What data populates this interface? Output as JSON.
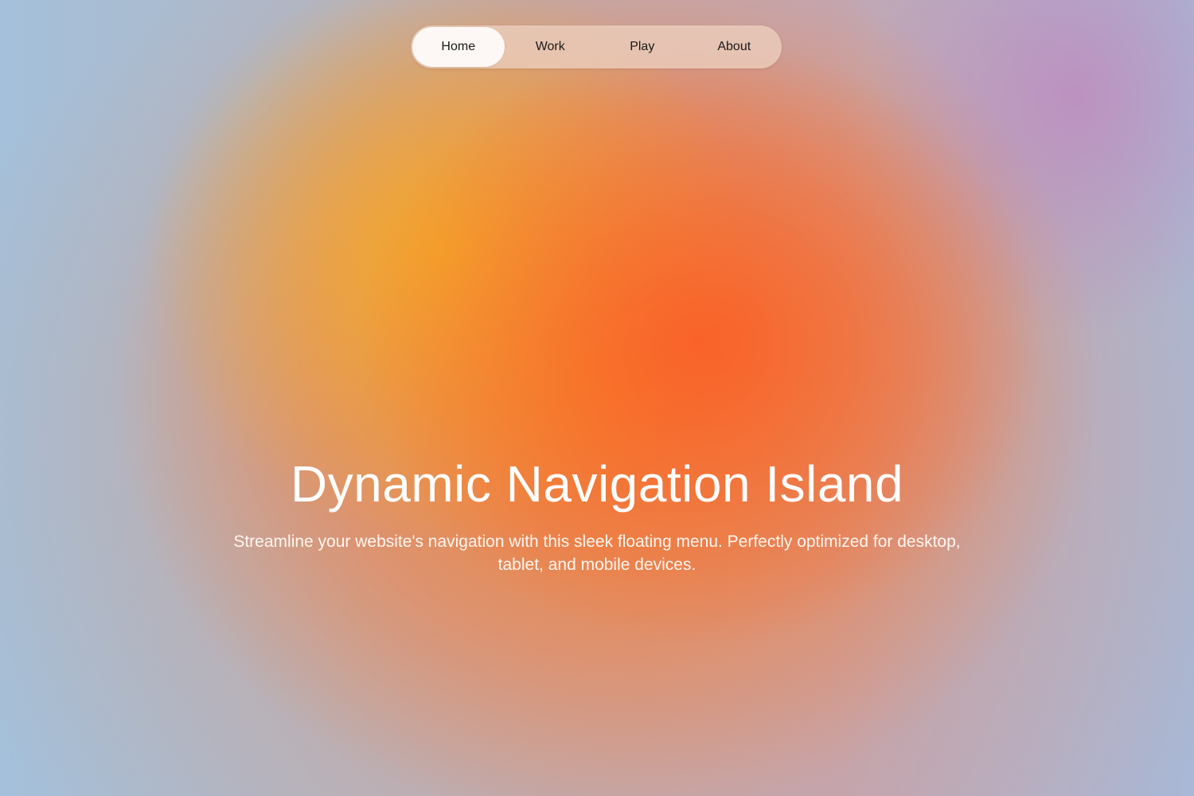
{
  "nav": {
    "items": [
      {
        "label": "Home",
        "active": true
      },
      {
        "label": "Work",
        "active": false
      },
      {
        "label": "Play",
        "active": false
      },
      {
        "label": "About",
        "active": false
      }
    ]
  },
  "hero": {
    "title": "Dynamic Navigation Island",
    "subtitle": "Streamline your website's navigation with this sleek floating menu. Perfectly optimized for desktop, tablet, and mobile devices."
  },
  "colors": {
    "accent_orange": "#f8762a",
    "accent_yellow": "#f2a93a",
    "background_blue": "#a9c0d8",
    "active_pill": "#fdf8f5",
    "text_light": "#ffffff"
  }
}
